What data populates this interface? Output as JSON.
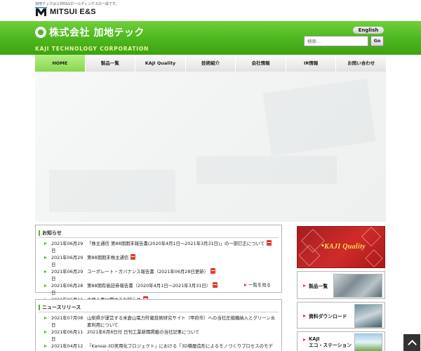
{
  "top": {
    "note": "加地テックは三井E&Sホールディングスの一員です。",
    "brand": "MITSUI E&S"
  },
  "header": {
    "logo_jp": "株式会社 加地テック",
    "logo_en": "KAJI TECHNOLOGY CORPORATION",
    "english_label": "English",
    "search_placeholder": "検索...",
    "go_label": "Go"
  },
  "nav": {
    "items": [
      {
        "label": "HOME"
      },
      {
        "label": "製品一覧"
      },
      {
        "label": "KAJI Quality"
      },
      {
        "label": "技術紹介"
      },
      {
        "label": "会社情報"
      },
      {
        "label": "IR情報"
      },
      {
        "label": "お問い合わせ"
      }
    ],
    "active_index": 0
  },
  "notices": {
    "title": "お知らせ",
    "items": [
      {
        "date": "2021年06月29日",
        "text": "「株主通信 第88期期末報告書(2020年4月1日～2021年3月31日)」の一部訂正について"
      },
      {
        "date": "2021年06月29日",
        "text": "第88期期末株主通信"
      },
      {
        "date": "2021年06月29日",
        "text": "コーポレート・ガバナンス報告書（2021年06月28日更新）"
      },
      {
        "date": "2021年06月28日",
        "text": "第88期有価証券報告書（2020年4月1日～2021年3月31日）"
      },
      {
        "date": "2021年06月11日",
        "text": "主要人事に関するお知らせ"
      }
    ],
    "more_label": "一覧を見る"
  },
  "news": {
    "title": "ニュースリリース",
    "items": [
      {
        "date": "2021年07月08日",
        "text": "山梨県が運営する米倉山電力貯蔵技術研究サイト（甲府市）への当社圧縮機納入とグリーン水素利用について"
      },
      {
        "date": "2021年06月11日",
        "text": "2021年6月8日付 日刊工業新聞掲載の当社記事について"
      },
      {
        "date": "2021年04月12日",
        "text": "「Kansai-3D実用化プロジェクト」における「3D積層造形によるモノづくりプロセスのモデル化」の成果発表会に参加"
      }
    ]
  },
  "side": {
    "kq_label": "KAJI Quality",
    "products_label": "製品一覧",
    "download_label": "資料ダウンロード",
    "eco_line1": "KAJI",
    "eco_line2": "エコ・ステーション"
  },
  "colors": {
    "brand_green": "#4fb820",
    "active_nav": "#9be06a",
    "accent_red": "#e23b2e",
    "kq_red": "#c42626"
  }
}
